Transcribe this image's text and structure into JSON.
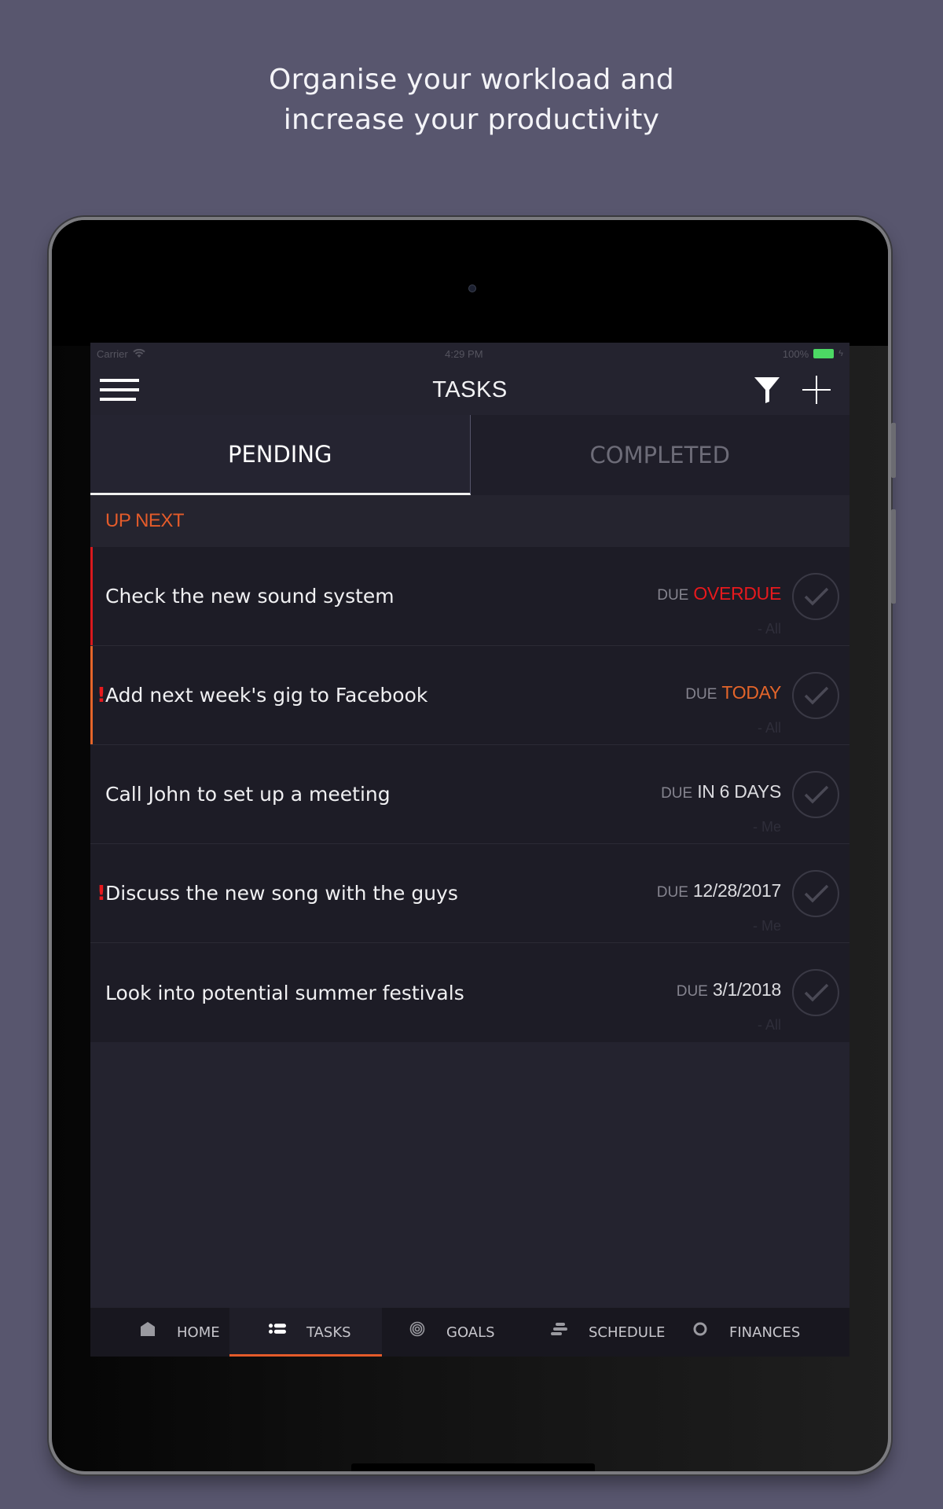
{
  "headline": {
    "line1": "Organise your workload and",
    "line2": "increase your productivity"
  },
  "statusbar": {
    "carrier": "Carrier",
    "time": "4:29 PM",
    "battery": "100%"
  },
  "navbar": {
    "title": "TASKS",
    "menu_icon": "hamburger-menu-icon",
    "filter_icon": "filter-icon",
    "add_icon": "plus-icon"
  },
  "tabs": [
    {
      "label": "PENDING",
      "active": true
    },
    {
      "label": "COMPLETED",
      "active": false
    }
  ],
  "section": {
    "title": "UP NEXT"
  },
  "colors": {
    "accent": "#e45b2a",
    "overdue": "#e8191d",
    "today": "#e4652a",
    "normal_due": "#dcdce0",
    "background": "#58566e"
  },
  "tasks": [
    {
      "title": "Check the new sound system",
      "due_label": "DUE",
      "due_value": "OVERDUE",
      "due_status": "overdue",
      "assignee": "- All",
      "important": false
    },
    {
      "title": "Add next week's gig to Facebook",
      "due_label": "DUE",
      "due_value": "TODAY",
      "due_status": "today",
      "assignee": "- All",
      "important": true
    },
    {
      "title": "Call John to set up a meeting",
      "due_label": "DUE",
      "due_value": "IN 6 DAYS",
      "due_status": "normal",
      "assignee": "- Me",
      "important": false
    },
    {
      "title": "Discuss the new song with the guys",
      "due_label": "DUE",
      "due_value": "12/28/2017",
      "due_status": "normal",
      "assignee": "- Me",
      "important": true
    },
    {
      "title": "Look into potential summer festivals",
      "due_label": "DUE",
      "due_value": "3/1/2018",
      "due_status": "normal",
      "assignee": "- All",
      "important": false
    }
  ],
  "important_marker": "!",
  "tabbar": [
    {
      "label": "HOME",
      "icon": "home-icon",
      "active": false
    },
    {
      "label": "TASKS",
      "icon": "tasks-list-icon",
      "active": true
    },
    {
      "label": "GOALS",
      "icon": "target-icon",
      "active": false
    },
    {
      "label": "SCHEDULE",
      "icon": "schedule-icon",
      "active": false
    },
    {
      "label": "FINANCES",
      "icon": "finances-icon",
      "active": false
    }
  ]
}
